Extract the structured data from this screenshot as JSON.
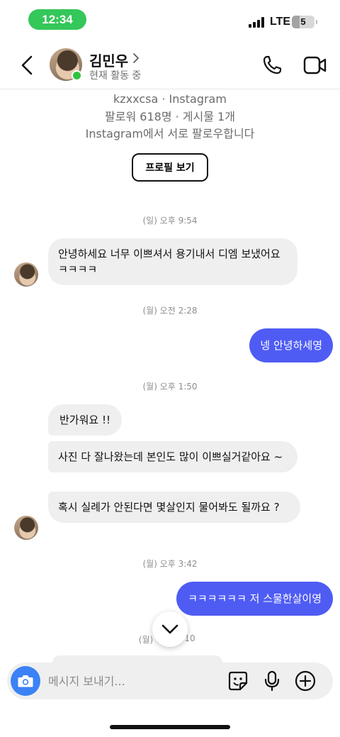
{
  "status_bar": {
    "time": "12:34",
    "network": "LTE",
    "battery_level": "5"
  },
  "header": {
    "name": "김민우",
    "presence": "현재 활동 중"
  },
  "profile": {
    "handle_line": "kzxxcsa · Instagram",
    "stats_line": "팔로워 618명 · 게시물 1개",
    "mutual_line": "Instagram에서 서로 팔로우합니다",
    "view_profile_label": "프로필 보기"
  },
  "thread": {
    "ts1": "(일) 오후 9:54",
    "m1": "안녕하세요 너무 이쁘셔서 용기내서 디엠 보냈어요 ㅋㅋㅋㅋ",
    "ts2": "(월) 오전 2:28",
    "m2": "넹 안녕하세영",
    "ts3": "(월) 오후 1:50",
    "m3": "반가워요 !!",
    "m4": "사진 다 잘나왔는데 본인도 많이 이쁘실거같아요 ~",
    "m5": "혹시 실례가 안된다면 몇살인지 물어봐도 될까요 ?",
    "ts4": "(월) 오후 3:42",
    "m6": "ㅋㅋㅋㅋㅋㅋ 저 스물한살이영",
    "ts5_partial_left": "(월)",
    "ts5_partial_right": ":10"
  },
  "composer": {
    "placeholder": "메시지 보내기..."
  },
  "icons": {
    "back": "chevron-left-icon",
    "call": "phone-icon",
    "video": "video-camera-icon",
    "camera": "camera-icon",
    "sticker": "sticker-icon",
    "mic": "microphone-icon",
    "plus": "plus-circle-icon",
    "scroll": "chevron-down-icon"
  },
  "colors": {
    "outgoing_bubble": "#4f5cf4",
    "incoming_bubble": "#efefef",
    "online": "#31c23e",
    "time_pill": "#34c759",
    "camera_button": "#3b82f6"
  }
}
